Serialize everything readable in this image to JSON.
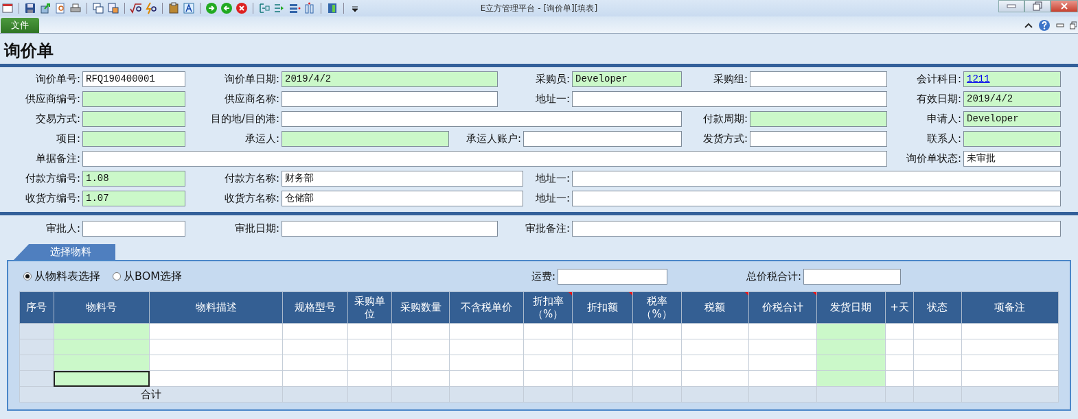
{
  "window": {
    "title": "E立方管理平台 - [询价单][填表]"
  },
  "menu": {
    "file_tab": "文件"
  },
  "page_title": "询价单",
  "form": {
    "fields": [
      {
        "label": "询价单号:",
        "value": "RFQ190400001",
        "highlighted": false
      },
      {
        "label": "询价单日期:",
        "value": "2019/4/2",
        "highlighted": true
      },
      {
        "label": "采购员:",
        "value": "Developer",
        "highlighted": true
      },
      {
        "label": "采购组:",
        "highlighted": false
      },
      {
        "label": "会计科目:",
        "link": "1211",
        "highlighted": true
      },
      {
        "label": "供应商编号:",
        "highlighted": true
      },
      {
        "label": "供应商名称:",
        "highlighted": false
      },
      {
        "label": "地址一:",
        "highlighted": false
      },
      {
        "label": "有效日期:",
        "value": "2019/4/2",
        "highlighted": true
      },
      {
        "label": "交易方式:",
        "highlighted": true
      },
      {
        "label": "目的地/目的港:",
        "highlighted": false
      },
      {
        "label": "付款周期:",
        "highlighted": true
      },
      {
        "label": "申请人:",
        "value": "Developer",
        "highlighted": true
      },
      {
        "label": "项目:",
        "highlighted": true
      },
      {
        "label": "承运人:",
        "highlighted": true
      },
      {
        "label": "承运人账户:",
        "highlighted": false
      },
      {
        "label": "发货方式:",
        "highlighted": false
      },
      {
        "label": "联系人:",
        "highlighted": true
      },
      {
        "label": "单据备注:",
        "highlighted": false
      },
      {
        "label": "询价单状态:",
        "value": "未审批",
        "highlighted": false
      },
      {
        "label": "付款方编号:",
        "value": "1.08",
        "highlighted": true
      },
      {
        "label": "付款方名称:",
        "value": "财务部",
        "highlighted": false
      },
      {
        "label": "地址一:",
        "highlighted": false
      },
      {
        "label": "收货方编号:",
        "value": "1.07",
        "highlighted": true
      },
      {
        "label": "收货方名称:",
        "value": "仓储部",
        "highlighted": false
      },
      {
        "label": "地址一:",
        "highlighted": false
      }
    ]
  },
  "approval": [
    {
      "label": "审批人:",
      "highlighted": false
    },
    {
      "label": "审批日期:",
      "highlighted": false
    },
    {
      "label": "审批备注:",
      "highlighted": false
    }
  ],
  "materials": {
    "tab": "选择物料",
    "sources": [
      {
        "label": "从物料表选择",
        "selected": true
      },
      {
        "label": "从BOM选择",
        "selected": false
      }
    ],
    "freight": {
      "label": "运费:"
    },
    "total": {
      "label": "总价税合计:"
    },
    "table": {
      "columns": [
        {
          "title": "序号",
          "kind": "index",
          "marked": false
        },
        {
          "title": "物料号",
          "kind": "highlighted",
          "marked": false
        },
        {
          "title": "物料描述",
          "kind": "plain",
          "marked": false
        },
        {
          "title": "规格型号",
          "kind": "plain",
          "marked": false
        },
        {
          "title": "采购单位",
          "kind": "plain",
          "marked": false
        },
        {
          "title": "采购数量",
          "kind": "plain",
          "marked": false
        },
        {
          "title": "不含税单价",
          "kind": "plain",
          "marked": false
        },
        {
          "title": "折扣率（%）",
          "kind": "plain",
          "marked": true
        },
        {
          "title": "折扣额",
          "kind": "plain",
          "marked": true
        },
        {
          "title": "税率（%）",
          "kind": "plain",
          "marked": false
        },
        {
          "title": "税额",
          "kind": "plain",
          "marked": true
        },
        {
          "title": "价税合计",
          "kind": "plain",
          "marked": true
        },
        {
          "title": "发货日期",
          "kind": "highlighted",
          "marked": false
        },
        {
          "title": "+天",
          "kind": "plain",
          "marked": false
        },
        {
          "title": "状态",
          "kind": "plain",
          "marked": false
        },
        {
          "title": "项备注",
          "kind": "plain",
          "marked": false
        }
      ],
      "rows": [
        {
          "focused": false
        },
        {
          "focused": false
        },
        {
          "focused": false
        },
        {
          "focused": true
        }
      ],
      "footer_label": "合计"
    }
  }
}
